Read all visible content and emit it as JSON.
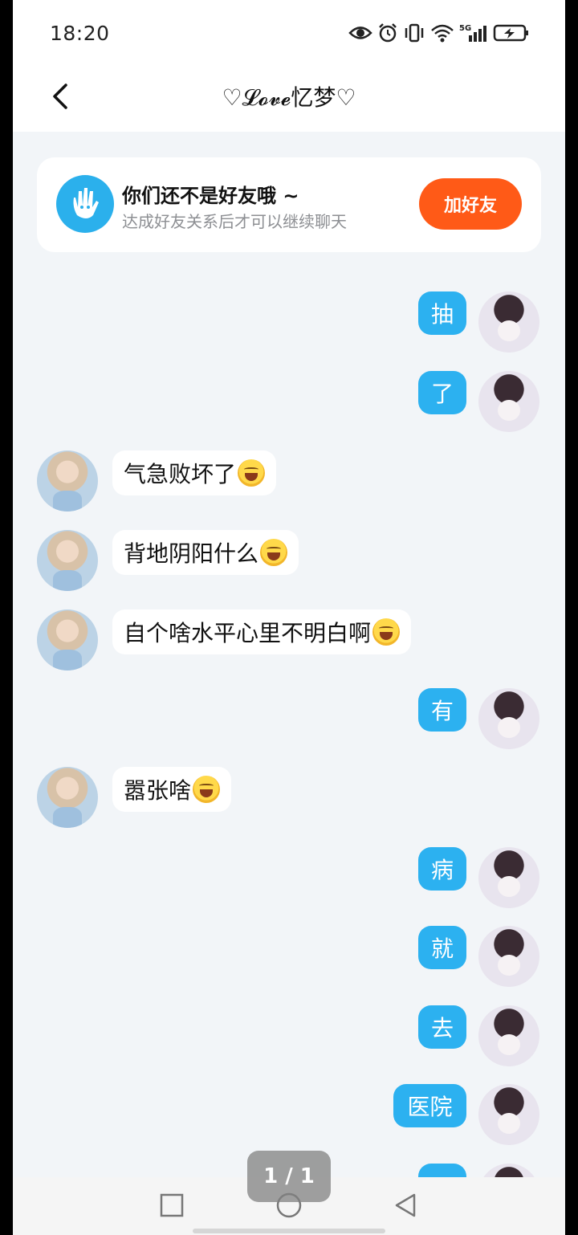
{
  "status_bar": {
    "time": "18:20"
  },
  "header": {
    "title": "♡𝓛𝓸𝓿𝓮忆梦♡"
  },
  "friend_notice": {
    "title": "你们还不是好友哦 ~",
    "subtitle": "达成好友关系后才可以继续聊天",
    "button_label": "加好友"
  },
  "messages": [
    {
      "from": "me",
      "text": "抽"
    },
    {
      "from": "me",
      "text": "了"
    },
    {
      "from": "other",
      "text": "气急败坏了",
      "emoji": "joy"
    },
    {
      "from": "other",
      "text": "背地阴阳什么",
      "emoji": "joy"
    },
    {
      "from": "other",
      "text": "自个啥水平心里不明白啊",
      "emoji": "joy"
    },
    {
      "from": "me",
      "text": "有"
    },
    {
      "from": "other",
      "text": "嚣张啥",
      "emoji": "joy"
    },
    {
      "from": "me",
      "text": "病"
    },
    {
      "from": "me",
      "text": "就"
    },
    {
      "from": "me",
      "text": "去"
    },
    {
      "from": "me",
      "text": "医院"
    }
  ],
  "page_indicator": "1 / 1",
  "colors": {
    "my_bubble": "#2cb1f0",
    "add_button": "#ff5a17",
    "background": "#f2f5f8"
  }
}
